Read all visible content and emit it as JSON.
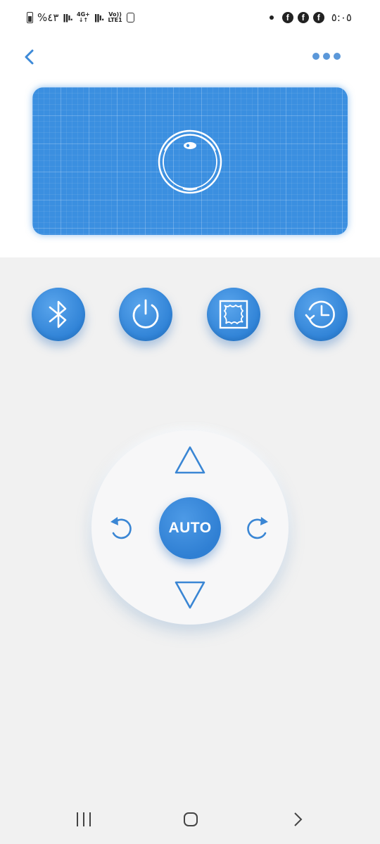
{
  "status_bar": {
    "battery_text": "%٤٣",
    "network_type": "4G+",
    "volte": "Vo))",
    "lte_label": "LTE1",
    "time": "٥:٠٥",
    "notification_icons": [
      "facebook-icon",
      "facebook-icon",
      "facebook-icon"
    ]
  },
  "header": {
    "back_icon": "chevron-left-icon",
    "more_icon": "more-dots-icon"
  },
  "device_card": {
    "icon": "robot-vacuum-icon",
    "accent_color": "#3b8fe0"
  },
  "function_buttons": [
    {
      "name": "bluetooth",
      "icon": "bluetooth-icon"
    },
    {
      "name": "power",
      "icon": "power-icon"
    },
    {
      "name": "edge-clean",
      "icon": "edge-clean-icon"
    },
    {
      "name": "schedule",
      "icon": "schedule-clock-icon"
    }
  ],
  "dpad": {
    "center_label": "AUTO",
    "up_icon": "arrow-up-icon",
    "down_icon": "arrow-down-icon",
    "left_icon": "rotate-left-icon",
    "right_icon": "rotate-right-icon"
  },
  "nav_bar": {
    "recent_icon": "recent-apps-icon",
    "home_icon": "home-icon",
    "back_icon": "nav-back-icon"
  },
  "colors": {
    "primary": "#3388dd",
    "background": "#f1f1f1"
  }
}
